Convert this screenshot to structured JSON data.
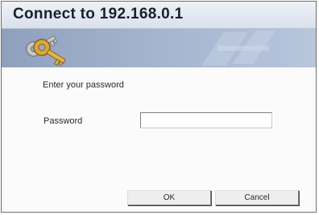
{
  "dialog": {
    "title": "Connect to 192.168.0.1",
    "banner_icon": "keys-icon",
    "prompt": "Enter your password",
    "password_label": "Password",
    "password_value": "",
    "ok_label": "OK",
    "cancel_label": "Cancel"
  },
  "colors": {
    "banner": "#a3b3ce",
    "titlebar": "#dfe6ef",
    "key_gold": "#d7a93c"
  }
}
